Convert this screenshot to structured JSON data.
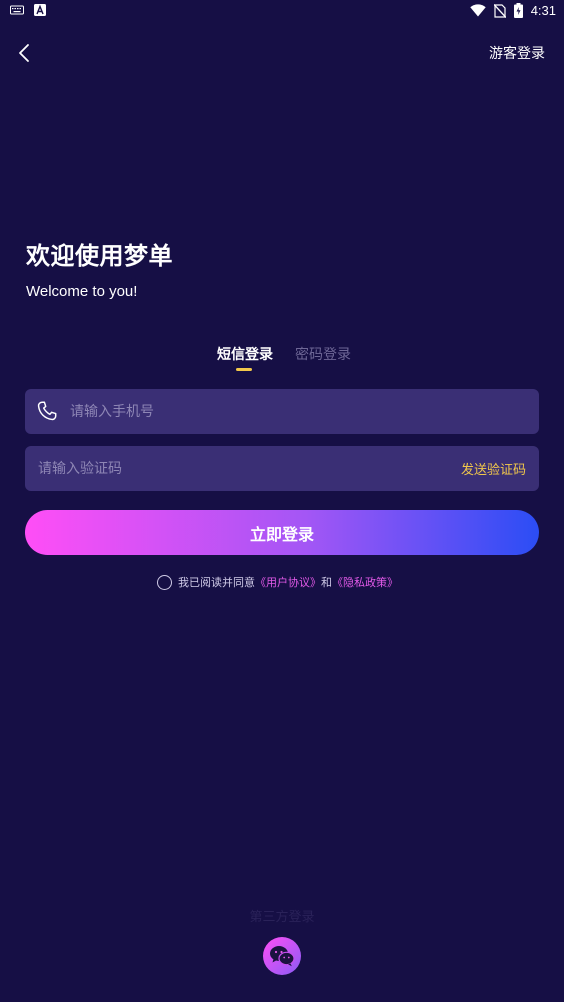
{
  "status_bar": {
    "time": "4:31",
    "left_icons": [
      "keyboard-icon",
      "a-icon"
    ],
    "right_icons": [
      "wifi-icon",
      "no-sim-icon",
      "battery-charging-icon"
    ]
  },
  "top_bar": {
    "back_icon": "chevron-left-icon",
    "guest_login": "游客登录"
  },
  "welcome": {
    "title": "欢迎使用梦单",
    "subtitle": "Welcome to you!"
  },
  "tabs": [
    {
      "label": "短信登录",
      "active": true
    },
    {
      "label": "密码登录",
      "active": false
    }
  ],
  "phone_field": {
    "icon": "phone-icon",
    "placeholder": "请输入手机号",
    "value": ""
  },
  "code_field": {
    "placeholder": "请输入验证码",
    "value": "",
    "send_code_label": "发送验证码"
  },
  "login_button": "立即登录",
  "agreement": {
    "prefix": "我已阅读并同意",
    "user_agreement": "《用户协议》",
    "conjunction": "和",
    "privacy_policy": "《隐私政策》",
    "checked": false
  },
  "third_party": {
    "label": "第三方登录",
    "wechat_icon": "wechat-icon"
  },
  "colors": {
    "background": "#160f45",
    "field": "#3a2f75",
    "accent_yellow": "#f2c84b",
    "link_pink": "#e25ae8",
    "gradient_start": "#ff4ef6",
    "gradient_end": "#2b4df5"
  }
}
